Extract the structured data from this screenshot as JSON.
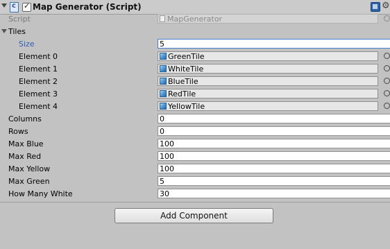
{
  "component": {
    "title": "Map Generator (Script)",
    "script_label": "Script",
    "script_value": "MapGenerator"
  },
  "tiles": {
    "label": "Tiles",
    "size_label": "Size",
    "size_value": "5",
    "elements": [
      {
        "label": "Element 0",
        "value": "GreenTile"
      },
      {
        "label": "Element 1",
        "value": "WhiteTile"
      },
      {
        "label": "Element 2",
        "value": "BlueTile"
      },
      {
        "label": "Element 3",
        "value": "RedTile"
      },
      {
        "label": "Element 4",
        "value": "YellowTile"
      }
    ]
  },
  "fields": [
    {
      "label": "Columns",
      "value": "0"
    },
    {
      "label": "Rows",
      "value": "0"
    },
    {
      "label": "Max Blue",
      "value": "100"
    },
    {
      "label": "Max Red",
      "value": "100"
    },
    {
      "label": "Max Yellow",
      "value": "100"
    },
    {
      "label": "Max Green",
      "value": "5"
    },
    {
      "label": "How Many White",
      "value": "30"
    }
  ],
  "add_component_label": "Add Component",
  "icons": {
    "script": "csharp-script-icon",
    "help": "help-icon",
    "settings": "gear-icon",
    "object": "prefab-cube-icon",
    "picker": "object-picker-icon"
  },
  "colors": {
    "background": "#c2c2c2",
    "header": "#cbcbcb",
    "accent": "#4c7ed3",
    "size_label": "#2e5fb5"
  }
}
